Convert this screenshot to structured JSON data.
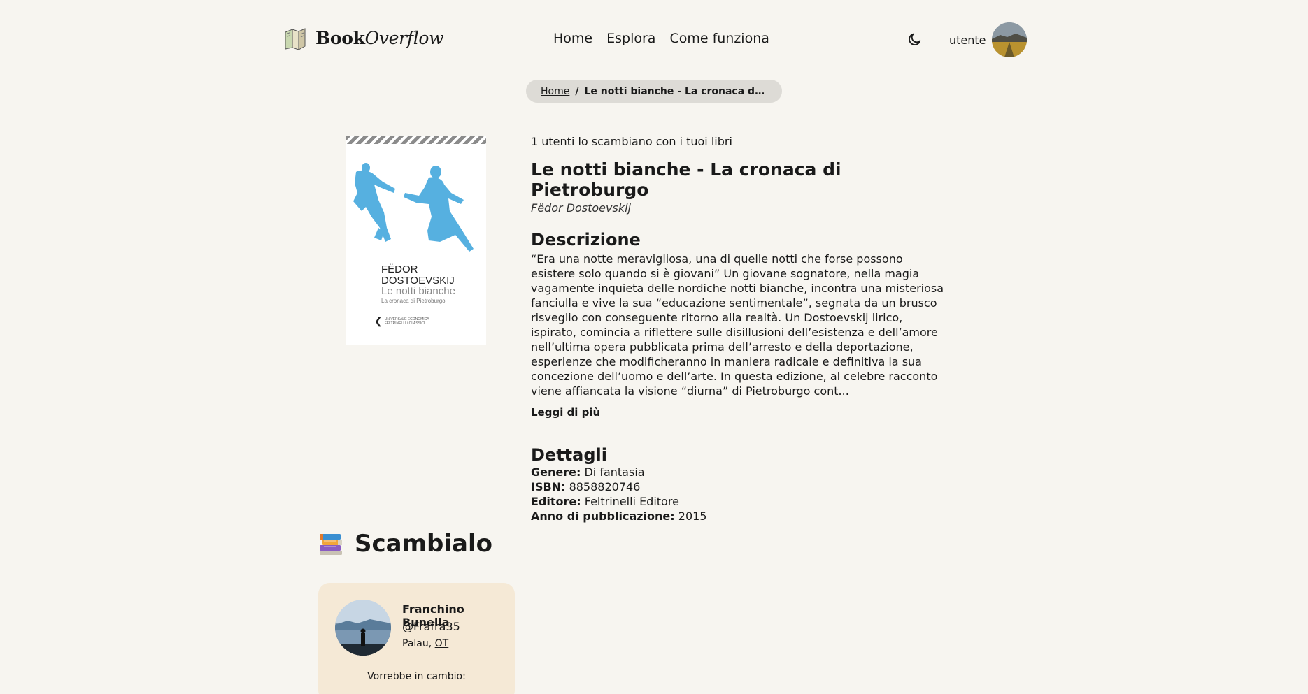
{
  "header": {
    "brand_bold": "Book",
    "brand_italic": "Overflow",
    "nav": [
      "Home",
      "Esplora",
      "Come funziona"
    ],
    "user_label": "utente",
    "icons": {
      "logo": "book-stack-logo-icon",
      "theme": "moon-icon"
    }
  },
  "breadcrumb": {
    "home": "Home",
    "separator": "/",
    "current": "Le notti bianche - La cronaca di Pietroburgo"
  },
  "cover": {
    "author": "FËDOR DOSTOEVSKIJ",
    "title": "Le notti bianche",
    "subtitle": "La cronaca di Pietroburgo",
    "publisher": "UNIVERSALE ECONOMICA FELTRINELLI / CLASSICI",
    "accent_color": "#56b0e0"
  },
  "book": {
    "swap_count_text": "1 utenti lo scambiano con i tuoi libri",
    "title": "Le notti bianche - La cronaca di Pietroburgo",
    "author": "Fëdor Dostoevskij",
    "description_heading": "Descrizione",
    "description": "“Era una notte meravigliosa, una di quelle notti che forse possono esistere solo quando si è giovani” Un giovane sognatore, nella magia vagamente inquieta delle nordiche notti bianche, incontra una misteriosa fanciulla e vive la sua “educazione sentimentale”, segnata da un brusco risveglio con conseguente ritorno alla realtà. Un Dostoevskij lirico, ispirato, comincia a riflettere sulle disillusioni dell’esistenza e dell’amore nell’ultima opera pubblicata prima dell’arresto e della deportazione, esperienze che modificheranno in maniera radicale e definitiva la sua concezione dell’uomo e dell’arte. In questa edizione, al celebre racconto viene affiancata la visione “diurna” di Pietroburgo cont...",
    "read_more": "Leggi di più",
    "details_heading": "Dettagli",
    "details": [
      {
        "key": "Genere:",
        "value": "Di fantasia"
      },
      {
        "key": "ISBN:",
        "value": "8858820746"
      },
      {
        "key": "Editore:",
        "value": "Feltrinelli Editore"
      },
      {
        "key": "Anno di pubblicazione:",
        "value": "2015"
      }
    ]
  },
  "swap": {
    "heading": "Scambialo",
    "offer": {
      "name": "Franchino Bunella",
      "handle": "@Frafra35",
      "city": "Palau, ",
      "province": "OT",
      "wants_label": "Vorrebbe in cambio:"
    }
  },
  "colors": {
    "background": "#f7f5f0",
    "card": "#f5e9d6",
    "breadcrumb_bg": "#dddbd6"
  }
}
